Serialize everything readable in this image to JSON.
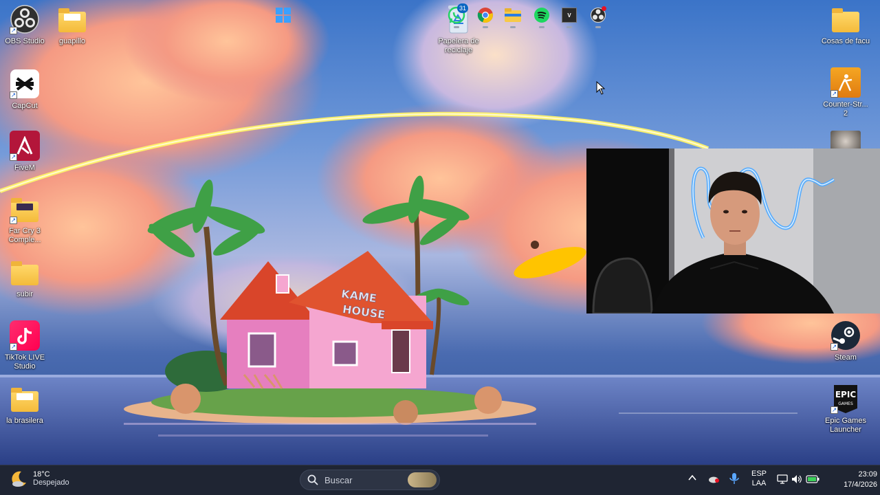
{
  "desktop": {
    "icons_left": [
      {
        "name": "obs-studio",
        "label": "OBS Studio"
      },
      {
        "name": "capcut",
        "label": "CapCut"
      },
      {
        "name": "fivem",
        "label": "FiveM"
      },
      {
        "name": "far-cry-3",
        "label": "Far Cry 3 Comple..."
      },
      {
        "name": "subir",
        "label": "subir"
      },
      {
        "name": "tiktok-live-studio",
        "label": "TikTok LIVE Studio"
      },
      {
        "name": "la-brasilera",
        "label": "la brasilera"
      }
    ],
    "icon_guapillo": "guapillo",
    "icon_recycle_bin": "Papelera de reciclaje",
    "icons_right": [
      {
        "name": "cosas-de-facu",
        "label": "Cosas de facu"
      },
      {
        "name": "counter-strike-2",
        "label": "Counter-Str... 2"
      },
      {
        "name": "steam",
        "label": "Steam"
      },
      {
        "name": "epic-games-launcher",
        "label": "Epic Games Launcher"
      }
    ],
    "wallpaper_sign": "KAME HOUSE"
  },
  "taskbar": {
    "weather": {
      "temp": "18°C",
      "condition": "Despejado",
      "icon": "moon-cloud-icon"
    },
    "search_placeholder": "Buscar",
    "whatsapp_badge": "31",
    "apps": [
      "start-icon",
      "whatsapp-icon",
      "chrome-icon",
      "file-explorer-icon",
      "spotify-icon",
      "gta-icon",
      "obs-taskbar-icon"
    ],
    "language": {
      "line1": "ESP",
      "line2": "LAA"
    },
    "clock": {
      "time": "23:09",
      "date": "17/4/2026"
    }
  },
  "colors": {
    "taskbar_bg": "#1f2533",
    "sky": "#3b74c8",
    "accent": "#0078d4"
  }
}
